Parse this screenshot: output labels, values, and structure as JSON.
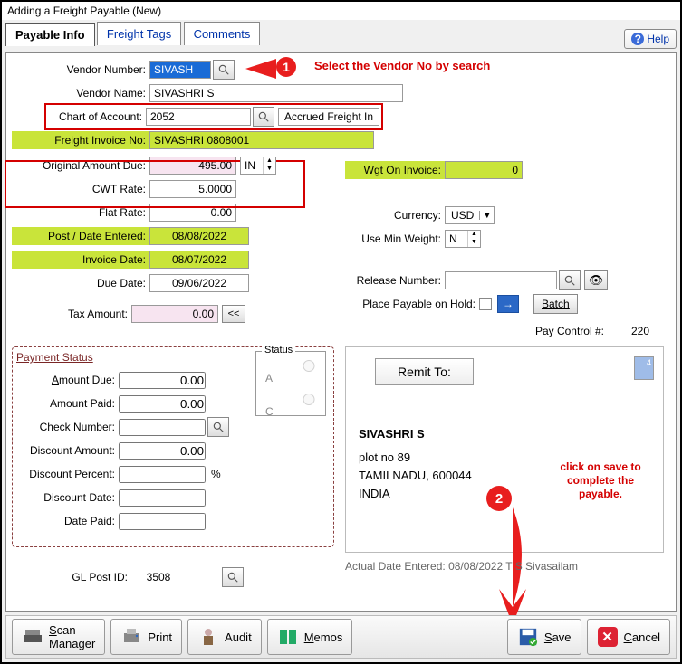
{
  "window_title": "Adding a Freight Payable  (New)",
  "tabs": {
    "payable": "Payable Info",
    "freight": "Freight Tags",
    "comments": "Comments"
  },
  "help": "Help",
  "annotations": {
    "a1": "Select the Vendor No by search",
    "a2": "click on save to complete the payable.",
    "b1": "1",
    "b2": "2"
  },
  "labels": {
    "vendor_no": "Vendor Number:",
    "vendor_name": "Vendor Name:",
    "coa": "Chart of Account:",
    "coa_name": "Accrued Freight In",
    "freight_inv": "Freight Invoice No:",
    "orig_due": "Original Amount Due:",
    "cwt": "CWT Rate:",
    "flat": "Flat Rate:",
    "post_date": "Post / Date Entered:",
    "inv_date": "Invoice Date:",
    "due_date": "Due Date:",
    "tax_amt": "Tax Amount:",
    "wgt": "Wgt On Invoice:",
    "currency": "Currency:",
    "min_wgt": "Use Min Weight:",
    "release": "Release Number:",
    "hold": "Place Payable on Hold:",
    "batch": "Batch",
    "paycontrol": "Pay Control #:",
    "gl": "GL Post  ID:"
  },
  "vals": {
    "vendor_no": "SIVASH",
    "vendor_name": "SIVASHRI S",
    "coa": "2052",
    "freight_inv": "SIVASHRI 0808001",
    "orig_due": "495.00",
    "orig_unit": "IN",
    "cwt": "5.0000",
    "flat": "0.00",
    "post_date": "08/08/2022",
    "inv_date": "08/07/2022",
    "due_date": "09/06/2022",
    "tax_amt": "0.00",
    "wgt": "0",
    "currency": "USD",
    "min_wgt": "N",
    "release": "",
    "paycontrol": "220",
    "gl": "3508"
  },
  "payment": {
    "title": "Payment Status",
    "status_label": "Status",
    "opt_a": "A",
    "opt_c": "C",
    "amount_due_l": "Amount Due:",
    "amount_due": "0.00",
    "amount_paid_l": "Amount Paid:",
    "amount_paid": "0.00",
    "check_l": "Check Number:",
    "check": "",
    "disc_amt_l": "Discount Amount:",
    "disc_amt": "0.00",
    "disc_pct_l": "Discount Percent:",
    "disc_pct": "",
    "pct": "%",
    "disc_date_l": "Discount Date:",
    "disc_date": "",
    "date_paid_l": "Date Paid:",
    "date_paid": ""
  },
  "remit": {
    "btn": "Remit To:",
    "stamp": "4",
    "name": "SIVASHRI S",
    "line1": "plot no 89",
    "line2": "TAMILNADU,  600044",
    "line3": "INDIA"
  },
  "meta": "Actual Date Entered: 08/08/2022     T S Sivasailam",
  "buttons": {
    "scan": "Scan Manager",
    "print": "Print",
    "audit": "Audit",
    "memos": "Memos",
    "save": "Save",
    "cancel": "Cancel"
  }
}
